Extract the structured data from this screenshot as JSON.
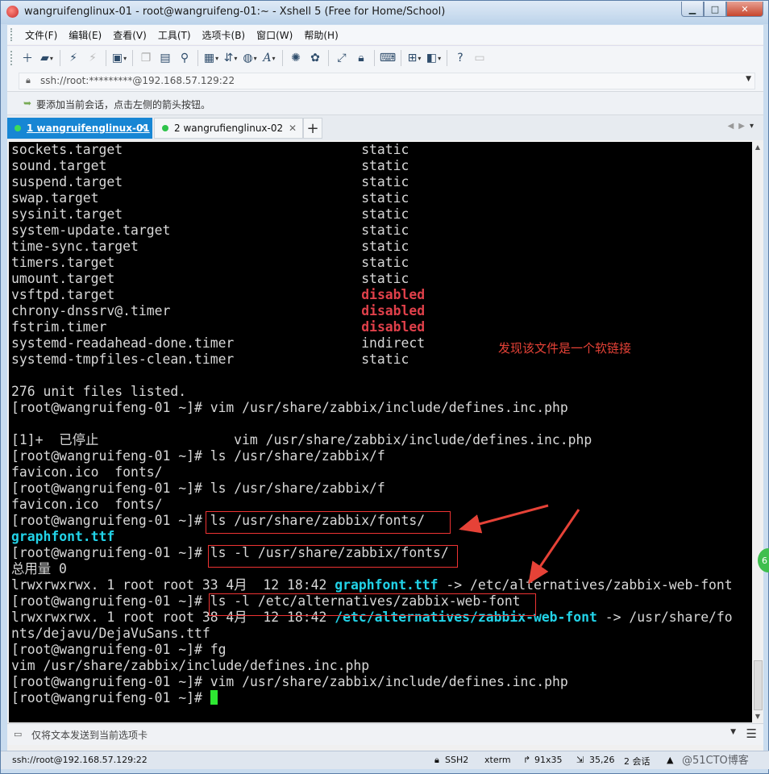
{
  "window": {
    "title": "wangruifenglinux-01 - root@wangruifeng-01:~ - Xshell 5 (Free for Home/School)",
    "controls": {
      "minimize": "▁",
      "maximize": "□",
      "close": "✕"
    }
  },
  "menu": [
    "文件(F)",
    "编辑(E)",
    "查看(V)",
    "工具(T)",
    "选项卡(B)",
    "窗口(W)",
    "帮助(H)"
  ],
  "address": {
    "value": "ssh://root:*********@192.168.57.129:22"
  },
  "hint": {
    "text": "要添加当前会话，点击左侧的箭头按钮。"
  },
  "tabs": [
    {
      "label": "1 wangruifenglinux-01",
      "active": true
    },
    {
      "label": "2 wangrufienglinux-02",
      "active": false
    }
  ],
  "terminal": {
    "lines": [
      [
        {
          "t": "sockets.target                              static"
        }
      ],
      [
        {
          "t": "sound.target                                static"
        }
      ],
      [
        {
          "t": "suspend.target                              static"
        }
      ],
      [
        {
          "t": "swap.target                                 static"
        }
      ],
      [
        {
          "t": "sysinit.target                              static"
        }
      ],
      [
        {
          "t": "system-update.target                        static"
        }
      ],
      [
        {
          "t": "time-sync.target                            static"
        }
      ],
      [
        {
          "t": "timers.target                               static"
        }
      ],
      [
        {
          "t": "umount.target                               static"
        }
      ],
      [
        {
          "t": "vsftpd.target                               "
        },
        {
          "t": "disabled",
          "c": "red"
        }
      ],
      [
        {
          "t": "chrony-dnssrv@.timer                        "
        },
        {
          "t": "disabled",
          "c": "red"
        }
      ],
      [
        {
          "t": "fstrim.timer                                "
        },
        {
          "t": "disabled",
          "c": "red"
        }
      ],
      [
        {
          "t": "systemd-readahead-done.timer                indirect"
        }
      ],
      [
        {
          "t": "systemd-tmpfiles-clean.timer                static"
        }
      ],
      [
        {
          "t": ""
        }
      ],
      [
        {
          "t": "276 unit files listed."
        }
      ],
      [
        {
          "t": "[root@wangruifeng-01 ~]# vim /usr/share/zabbix/include/defines.inc.php"
        }
      ],
      [
        {
          "t": ""
        }
      ],
      [
        {
          "t": "[1]+  已停止                 vim /usr/share/zabbix/include/defines.inc.php"
        }
      ],
      [
        {
          "t": "[root@wangruifeng-01 ~]# ls /usr/share/zabbix/f"
        }
      ],
      [
        {
          "t": "favicon.ico  fonts/"
        }
      ],
      [
        {
          "t": "[root@wangruifeng-01 ~]# ls /usr/share/zabbix/f"
        }
      ],
      [
        {
          "t": "favicon.ico  fonts/"
        }
      ],
      [
        {
          "t": "[root@wangruifeng-01 ~]# ls /usr/share/zabbix/fonts/"
        }
      ],
      [
        {
          "t": "graphfont.ttf",
          "c": "cyan"
        }
      ],
      [
        {
          "t": "[root@wangruifeng-01 ~]# ls -l /usr/share/zabbix/fonts/"
        }
      ],
      [
        {
          "t": "总用量 0"
        }
      ],
      [
        {
          "t": "lrwxrwxrwx. 1 root root 33 4月  12 18:42 "
        },
        {
          "t": "graphfont.ttf",
          "c": "cyan"
        },
        {
          "t": " -> /etc/alternatives/zabbix-web-font"
        }
      ],
      [
        {
          "t": "[root@wangruifeng-01 ~]# ls -l /etc/alternatives/zabbix-web-font"
        }
      ],
      [
        {
          "t": "lrwxrwxrwx. 1 root root 38 4月  12 18:42 "
        },
        {
          "t": "/etc/alternatives/zabbix-web-font",
          "c": "cyan"
        },
        {
          "t": " -> /usr/share/fo"
        }
      ],
      [
        {
          "t": "nts/dejavu/DejaVuSans.ttf"
        }
      ],
      [
        {
          "t": "[root@wangruifeng-01 ~]# fg"
        }
      ],
      [
        {
          "t": "vim /usr/share/zabbix/include/defines.inc.php"
        }
      ],
      [
        {
          "t": "[root@wangruifeng-01 ~]# vim /usr/share/zabbix/include/defines.inc.php"
        }
      ],
      [
        {
          "t": "[root@wangruifeng-01 ~]# "
        },
        {
          "t": "",
          "c": "cursor"
        }
      ]
    ]
  },
  "annotation": {
    "text": "发现该文件是一个软链接"
  },
  "inputbar": {
    "placeholder": "仅将文本发送到当前选项卡"
  },
  "status": {
    "address": "ssh://root@192.168.57.129:22",
    "protocol": "SSH2",
    "terminal": "xterm",
    "size": "91x35",
    "cursor": "35,26",
    "sessions": "2 会话"
  },
  "side_bubble": "6",
  "watermark": "@51CTO博客",
  "colors": {
    "tab_active": "#1786d4",
    "terminal_bg": "#000000",
    "disabled": "#e0404a",
    "link": "#22d3e8",
    "cursor": "#2ee832",
    "annotation": "#e64237"
  }
}
